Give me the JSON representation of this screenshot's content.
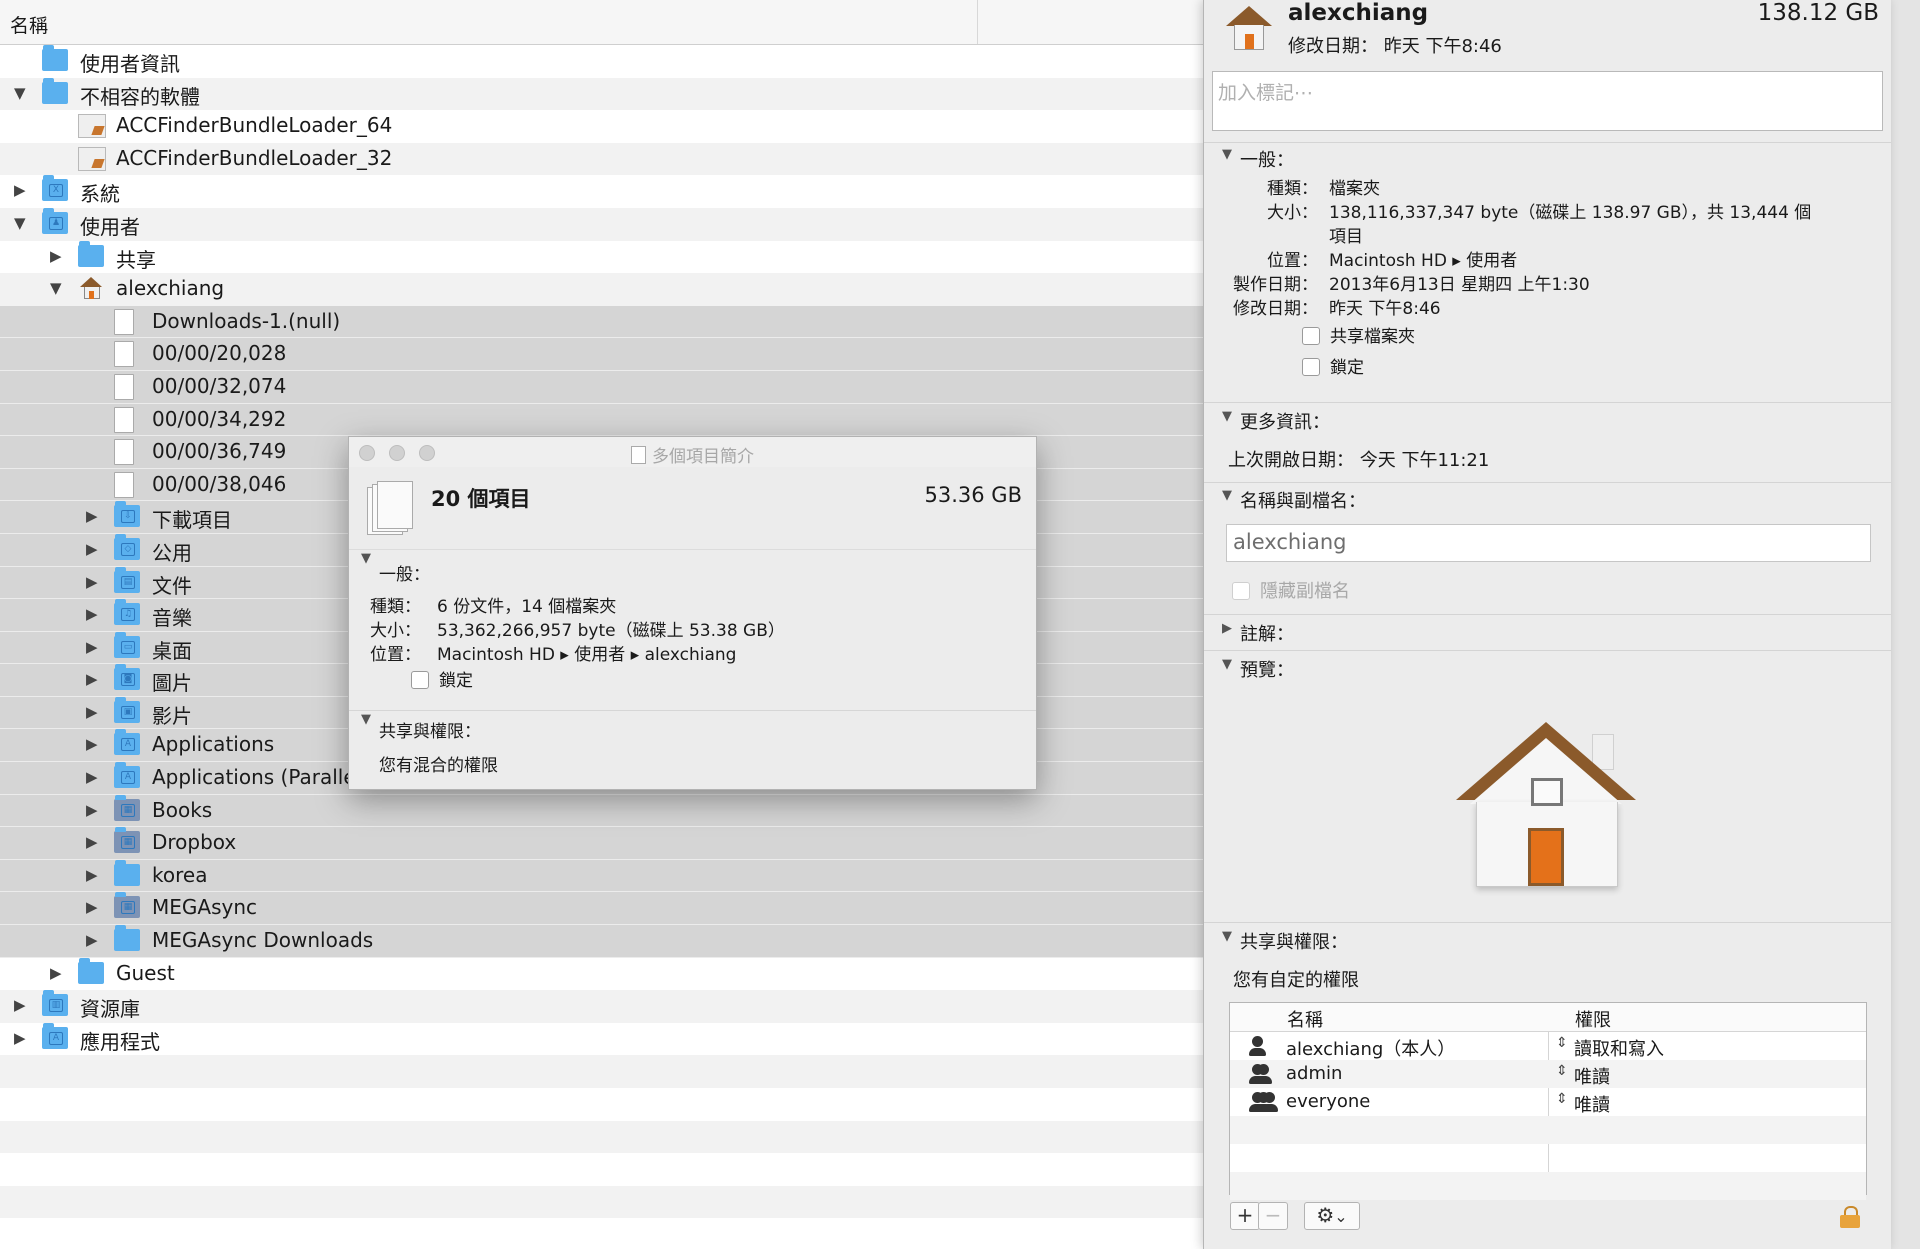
{
  "finder": {
    "column_header": "名稱",
    "rows": [
      {
        "indent": 0,
        "disclosure": "",
        "icon": "folder",
        "label": "使用者資訊",
        "style": "plain"
      },
      {
        "indent": 0,
        "disclosure": "▼",
        "icon": "folder",
        "label": "不相容的軟體",
        "style": "alt"
      },
      {
        "indent": 1,
        "disclosure": "",
        "icon": "app",
        "label": "ACCFinderBundleLoader_64",
        "style": "plain"
      },
      {
        "indent": 1,
        "disclosure": "",
        "icon": "app",
        "label": "ACCFinderBundleLoader_32",
        "style": "alt"
      },
      {
        "indent": 0,
        "disclosure": "▶",
        "icon": "folder-x",
        "label": "系統",
        "style": "plain"
      },
      {
        "indent": 0,
        "disclosure": "▼",
        "icon": "folder-user",
        "label": "使用者",
        "style": "alt"
      },
      {
        "indent": 1,
        "disclosure": "▶",
        "icon": "folder",
        "label": "共享",
        "style": "plain"
      },
      {
        "indent": 1,
        "disclosure": "▼",
        "icon": "home",
        "label": "alexchiang",
        "style": "alt"
      },
      {
        "indent": 2,
        "disclosure": "",
        "icon": "doc",
        "label": "Downloads-1.(null)",
        "style": "sel"
      },
      {
        "indent": 2,
        "disclosure": "",
        "icon": "doc",
        "label": "00/00/20,028",
        "style": "sel"
      },
      {
        "indent": 2,
        "disclosure": "",
        "icon": "doc",
        "label": "00/00/32,074",
        "style": "sel"
      },
      {
        "indent": 2,
        "disclosure": "",
        "icon": "doc",
        "label": "00/00/34,292",
        "style": "sel"
      },
      {
        "indent": 2,
        "disclosure": "",
        "icon": "doc",
        "label": "00/00/36,749",
        "style": "sel"
      },
      {
        "indent": 2,
        "disclosure": "",
        "icon": "doc",
        "label": "00/00/38,046",
        "style": "sel"
      },
      {
        "indent": 2,
        "disclosure": "▶",
        "icon": "folder-download",
        "label": "下載項目",
        "style": "sel"
      },
      {
        "indent": 2,
        "disclosure": "▶",
        "icon": "folder-public",
        "label": "公用",
        "style": "sel"
      },
      {
        "indent": 2,
        "disclosure": "▶",
        "icon": "folder-doc",
        "label": "文件",
        "style": "sel"
      },
      {
        "indent": 2,
        "disclosure": "▶",
        "icon": "folder-music",
        "label": "音樂",
        "style": "sel"
      },
      {
        "indent": 2,
        "disclosure": "▶",
        "icon": "folder-desktop",
        "label": "桌面",
        "style": "sel"
      },
      {
        "indent": 2,
        "disclosure": "▶",
        "icon": "folder-pictures",
        "label": "圖片",
        "style": "sel"
      },
      {
        "indent": 2,
        "disclosure": "▶",
        "icon": "folder-movies",
        "label": "影片",
        "style": "sel"
      },
      {
        "indent": 2,
        "disclosure": "▶",
        "icon": "folder-apps",
        "label": "Applications",
        "style": "sel"
      },
      {
        "indent": 2,
        "disclosure": "▶",
        "icon": "folder-apps",
        "label": "Applications (Parallels)",
        "style": "sel"
      },
      {
        "indent": 2,
        "disclosure": "▶",
        "icon": "folder-grey",
        "label": "Books",
        "style": "sel"
      },
      {
        "indent": 2,
        "disclosure": "▶",
        "icon": "folder-grey",
        "label": "Dropbox",
        "style": "sel"
      },
      {
        "indent": 2,
        "disclosure": "▶",
        "icon": "folder",
        "label": "korea",
        "style": "sel"
      },
      {
        "indent": 2,
        "disclosure": "▶",
        "icon": "folder-grey",
        "label": "MEGAsync",
        "style": "sel"
      },
      {
        "indent": 2,
        "disclosure": "▶",
        "icon": "folder",
        "label": "MEGAsync Downloads",
        "style": "sel"
      },
      {
        "indent": 1,
        "disclosure": "▶",
        "icon": "folder",
        "label": "Guest",
        "style": "plain"
      },
      {
        "indent": 0,
        "disclosure": "▶",
        "icon": "folder-library",
        "label": "資源庫",
        "style": "alt"
      },
      {
        "indent": 0,
        "disclosure": "▶",
        "icon": "folder-apps",
        "label": "應用程式",
        "style": "plain"
      },
      {
        "indent": 0,
        "disclosure": "",
        "icon": "",
        "label": "",
        "style": "alt"
      },
      {
        "indent": 0,
        "disclosure": "",
        "icon": "",
        "label": "",
        "style": "plain"
      },
      {
        "indent": 0,
        "disclosure": "",
        "icon": "",
        "label": "",
        "style": "alt"
      },
      {
        "indent": 0,
        "disclosure": "",
        "icon": "",
        "label": "",
        "style": "plain"
      },
      {
        "indent": 0,
        "disclosure": "",
        "icon": "",
        "label": "",
        "style": "alt"
      },
      {
        "indent": 0,
        "disclosure": "",
        "icon": "",
        "label": "",
        "style": "plain"
      },
      {
        "indent": 0,
        "disclosure": "",
        "icon": "",
        "label": "",
        "style": "alt"
      }
    ]
  },
  "multi_info": {
    "title": "多個項目簡介",
    "count": "20 個項目",
    "size": "53.36 GB",
    "general_header": "一般：",
    "kind_key": "種類：",
    "kind_val": "6 份文件，14 個檔案夾",
    "size_key": "大小：",
    "size_val": "53,362,266,957 byte（磁碟上 53.38 GB）",
    "where_key": "位置：",
    "where_val": "Macintosh HD ▸ 使用者 ▸ alexchiang",
    "locked": "鎖定",
    "sharing_header": "共享與權限：",
    "sharing_text": "您有混合的權限"
  },
  "info_panel": {
    "name": "alexchiang",
    "size": "138.12 GB",
    "modified_line": "修改日期： 昨天 下午8:46",
    "tags_placeholder": "加入標記⋯",
    "general_header": "一般：",
    "kind_key": "種類：",
    "kind_val": "檔案夾",
    "size_key": "大小：",
    "size_val": "138,116,337,347 byte（磁碟上 138.97 GB），共 13,444 個",
    "size_val2": "項目",
    "where_key": "位置：",
    "where_val": "Macintosh HD ▸ 使用者",
    "created_key": "製作日期：",
    "created_val": "2013年6月13日 星期四 上午1:30",
    "modified_key": "修改日期：",
    "modified_val": "昨天 下午8:46",
    "shared_folder": "共享檔案夾",
    "locked": "鎖定",
    "more_header": "更多資訊：",
    "last_opened": "上次開啟日期： 今天 下午11:21",
    "name_ext_header": "名稱與副檔名：",
    "name_field": "alexchiang",
    "hide_ext": "隱藏副檔名",
    "comments_header": "註解：",
    "preview_header": "預覽：",
    "sharing_header": "共享與權限：",
    "sharing_text": "您有自定的權限",
    "perm_col_name": "名稱",
    "perm_col_priv": "權限",
    "perm_rows": [
      {
        "name": "alexchiang（本人）",
        "priv": "讀取和寫入",
        "icon": "single-user-icon"
      },
      {
        "name": "admin",
        "priv": "唯讀",
        "icon": "group-icon"
      },
      {
        "name": "everyone",
        "priv": "唯讀",
        "icon": "everyone-icon"
      }
    ],
    "add_symbol": "+",
    "remove_symbol": "−",
    "gear_symbol": "⚙",
    "chevron_symbol": "⌄"
  }
}
